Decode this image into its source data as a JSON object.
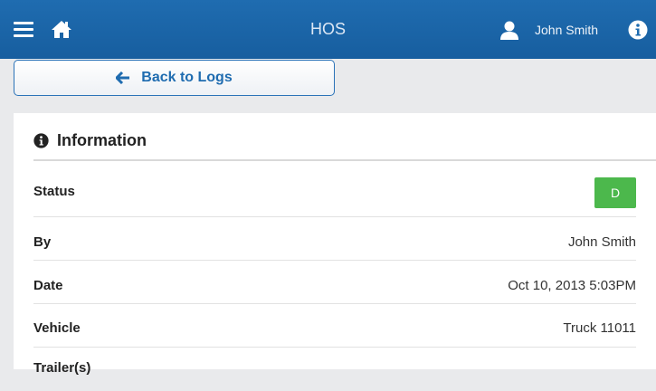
{
  "header": {
    "title": "HOS",
    "user_name": "John Smith",
    "icons": [
      "hamburger-menu-icon",
      "home-icon",
      "user-icon",
      "info-icon"
    ]
  },
  "back_button": {
    "label": "Back to Logs"
  },
  "info_panel": {
    "heading": "Information",
    "rows": [
      {
        "label": "Status",
        "value": "D",
        "badge_color": "#4cb84c"
      },
      {
        "label": "By",
        "value": "John Smith"
      },
      {
        "label": "Date",
        "value": "Oct 10, 2013 5:03PM"
      },
      {
        "label": "Vehicle",
        "value": "Truck 11011"
      },
      {
        "label": "Trailer(s)",
        "value": ""
      }
    ]
  },
  "colors": {
    "brand": "#1f6cb0",
    "status_on_duty_driving": "#4cb84c"
  }
}
